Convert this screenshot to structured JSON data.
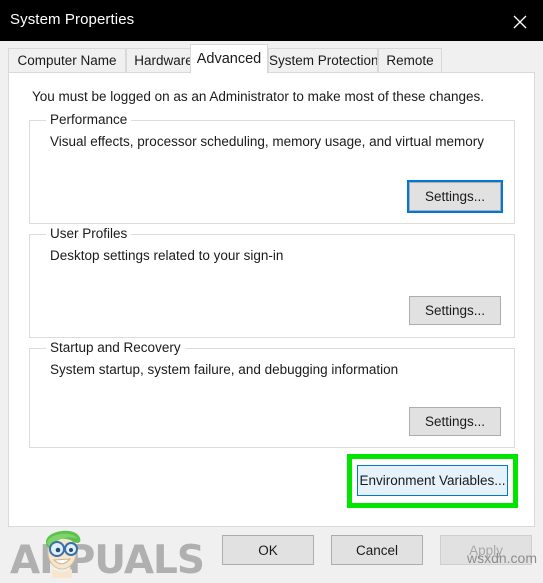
{
  "window": {
    "title": "System Properties",
    "close_icon": "close-icon",
    "titlebar_color": "#000000"
  },
  "tabs": [
    {
      "label": "Computer Name",
      "selected": false
    },
    {
      "label": "Hardware",
      "selected": false
    },
    {
      "label": "Advanced",
      "selected": true
    },
    {
      "label": "System Protection",
      "selected": false
    },
    {
      "label": "Remote",
      "selected": false
    }
  ],
  "panel": {
    "admin_note": "You must be logged on as an Administrator to make most of these changes.",
    "groups": [
      {
        "label": "Performance",
        "description": "Visual effects, processor scheduling, memory usage, and virtual memory",
        "button": "Settings...",
        "button_state": "focused"
      },
      {
        "label": "User Profiles",
        "description": "Desktop settings related to your sign-in",
        "button": "Settings...",
        "button_state": "normal"
      },
      {
        "label": "Startup and Recovery",
        "description": "System startup, system failure, and debugging information",
        "button": "Settings...",
        "button_state": "normal"
      }
    ],
    "environment_variables_button": "Environment Variables...",
    "environment_variables_state": "hover",
    "highlight_color": "#00e500"
  },
  "footer": {
    "ok": "OK",
    "cancel": "Cancel",
    "apply": "Apply",
    "apply_disabled": true
  },
  "watermarks": {
    "brand": "APPUALS",
    "site": "wsxdn.com"
  },
  "colors": {
    "accent": "#0078d7",
    "highlight": "#00e500",
    "dialog_bg": "#f0f0f0",
    "panel_bg": "#ffffff",
    "button_bg": "#e1e1e1",
    "hover_bg": "#e5f1fb"
  }
}
